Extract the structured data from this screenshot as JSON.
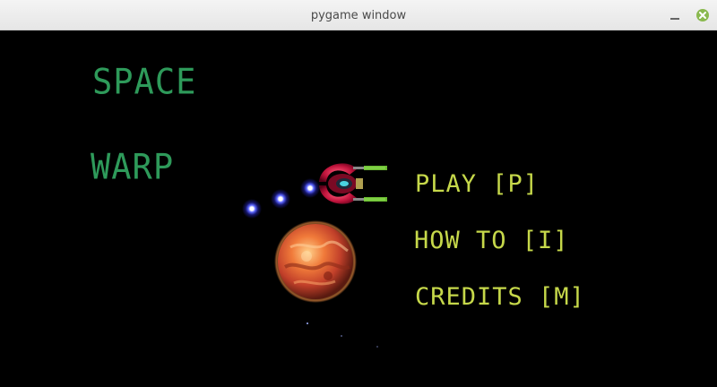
{
  "window": {
    "title": "pygame window",
    "controls": {
      "minimize_icon": "minimize-icon",
      "close_icon": "close-icon",
      "close_color": "#8ab94f"
    }
  },
  "game": {
    "background": "#000000",
    "logo": {
      "line1": "SPACE",
      "line2": "WARP",
      "color": "#2e9a5a"
    },
    "menu": {
      "color": "#c6d84a",
      "items": [
        {
          "label": "PLAY [P]"
        },
        {
          "label": "HOW TO [I]"
        },
        {
          "label": "CREDITS [M]"
        }
      ]
    },
    "sprites": [
      "spaceship-icon",
      "energy-orb-icon",
      "planet-icon"
    ]
  }
}
